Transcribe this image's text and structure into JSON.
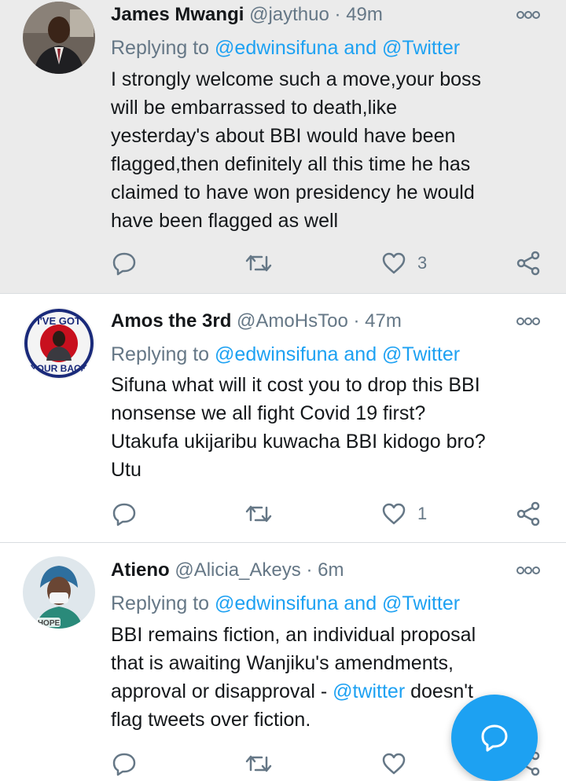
{
  "tweets": [
    {
      "name": "James Mwangi",
      "handle": "@jaythuo",
      "separator": "·",
      "time": "49m",
      "replying_prefix": "Replying to",
      "replying_to": "@edwinsifuna and @Twitter",
      "body": [
        "I strongly welcome such a move,your boss",
        "will be embarrassed to death,like",
        "yesterday's about BBI would have been",
        "flagged,then definitely all this time he has",
        "claimed to have won presidency he would",
        "have been flagged as well"
      ],
      "likes": "3",
      "avatar_icon": "man-in-suit-avatar"
    },
    {
      "name": "Amos the 3rd",
      "handle": "@AmoHsToo",
      "separator": "·",
      "time": "47m",
      "replying_prefix": "Replying to",
      "replying_to": "@edwinsifuna and @Twitter",
      "body": [
        "Sifuna what will it cost you to drop this BBI",
        "nonsense we all fight Covid 19 first?",
        "Utakufa ukijaribu kuwacha BBI kidogo bro?",
        "Utu"
      ],
      "likes": "1",
      "avatar_icon": "got-your-back-badge-avatar",
      "avatar_text_top": "I'VE GOT",
      "avatar_text_bottom": "YOUR BACK"
    },
    {
      "name": "Atieno",
      "handle": "@Alicia_Akeys",
      "separator": "·",
      "time": "6m",
      "replying_prefix": "Replying to",
      "replying_to": "@edwinsifuna and @Twitter",
      "body_lines": [
        {
          "text": "BBI remains fiction, an individual proposal"
        },
        {
          "text": "that is awaiting Wanjiku's amendments,"
        },
        {
          "pre": "approval or disapproval - ",
          "mention": "@twitter",
          "post": " doesn't"
        },
        {
          "text": "flag tweets over fiction."
        }
      ],
      "likes": "",
      "avatar_icon": "nurse-with-mask-avatar",
      "avatar_text": "HOPE"
    }
  ],
  "colors": {
    "accent": "#1da1f2",
    "secondary_text": "#657786",
    "highlight_bg": "#ebebeb"
  },
  "fab_icon": "compose-reply-icon"
}
